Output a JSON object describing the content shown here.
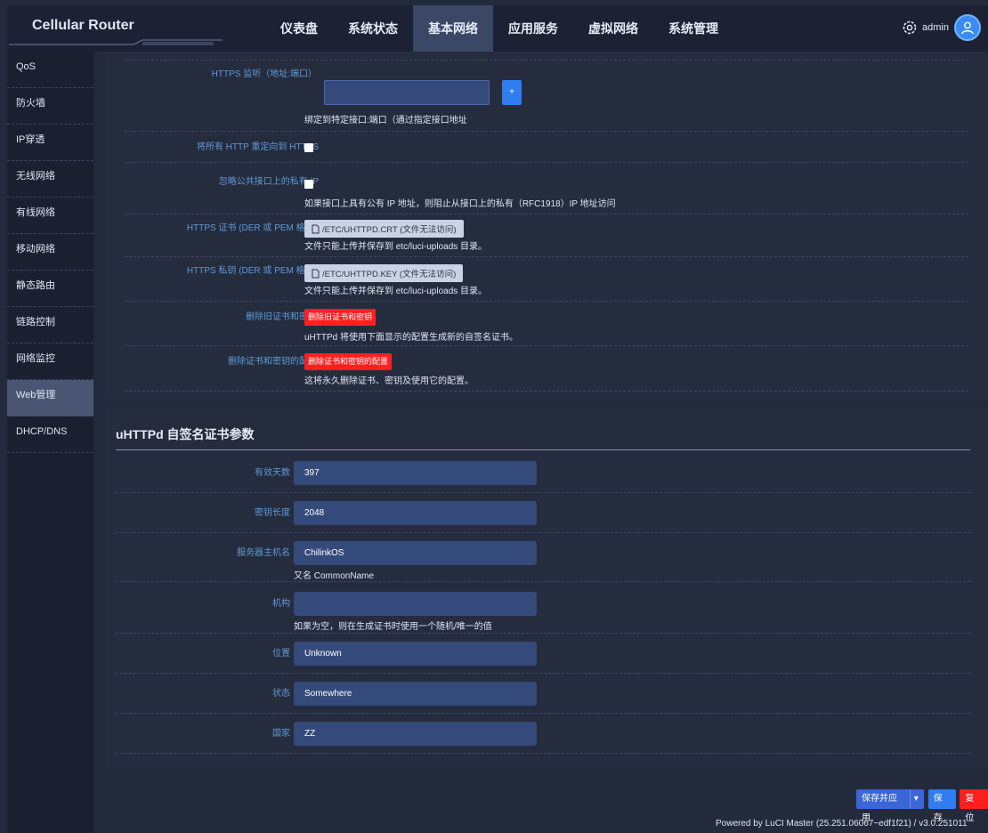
{
  "header": {
    "brand": "Cellular Router",
    "nav": [
      "仪表盘",
      "系统状态",
      "基本网络",
      "应用服务",
      "虚拟网络",
      "系统管理"
    ],
    "active_nav": "基本网络",
    "user": "admin"
  },
  "sidebar": {
    "items": [
      "QoS",
      "防火墙",
      "IP穿透",
      "无线网络",
      "有线网络",
      "移动网络",
      "静态路由",
      "链路控制",
      "网络监控",
      "Web管理",
      "DHCP/DNS"
    ],
    "active": "Web管理"
  },
  "https": {
    "listen_label": "HTTPS 监听（地址:端口）",
    "listen_desc": "绑定到特定接口:端口（通过指定接口地址",
    "add_symbol": "+",
    "redirect_label": "将所有 HTTP 重定向到 HTTPS",
    "ignore_label": "忽略公共接口上的私有 IP",
    "ignore_desc": "如果接口上具有公有 IP 地址，则阻止从接口上的私有（RFC1918）IP 地址访问",
    "cert_label": "HTTPS 证书 (DER 或 PEM 格式)",
    "cert_file": "/ETC/UHTTPD.CRT (文件无法访问)",
    "cert_desc": "文件只能上传并保存到 etc/luci-uploads 目录。",
    "key_label": "HTTPS 私钥 (DER 或 PEM 格式)",
    "key_file": "/ETC/UHTTPD.KEY (文件无法访问)",
    "key_desc": "文件只能上传并保存到 etc/luci-uploads 目录。",
    "remove_old_label": "删除旧证书和密钥",
    "remove_old_btn": "删除旧证书和密钥",
    "remove_old_desc": "uHTTPd 将使用下面显示的配置生成新的自签名证书。",
    "remove_conf_label": "删除证书和密钥的配置",
    "remove_conf_btn": "删除证书和密钥的配置",
    "remove_conf_desc": "这将永久删除证书、密钥及使用它的配置。"
  },
  "cert_params": {
    "title": "uHTTPd 自签名证书参数",
    "fields": [
      {
        "label": "有效天数",
        "value": "397",
        "desc": ""
      },
      {
        "label": "密钥长度",
        "value": "2048",
        "desc": ""
      },
      {
        "label": "服务器主机名",
        "value": "ChilinkOS",
        "desc": "又名 CommonName"
      },
      {
        "label": "机构",
        "value": "",
        "desc": "如果为空，则在生成证书时使用一个随机/唯一的值"
      },
      {
        "label": "位置",
        "value": "Unknown",
        "desc": ""
      },
      {
        "label": "状态",
        "value": "Somewhere",
        "desc": ""
      },
      {
        "label": "国家",
        "value": "ZZ",
        "desc": ""
      }
    ]
  },
  "footer": {
    "apply": "保存并应用",
    "save": "保存",
    "reset": "复位",
    "powered": "Powered by LuCI Master (25.251.06067~edf1f21) / v3.0.251011"
  }
}
